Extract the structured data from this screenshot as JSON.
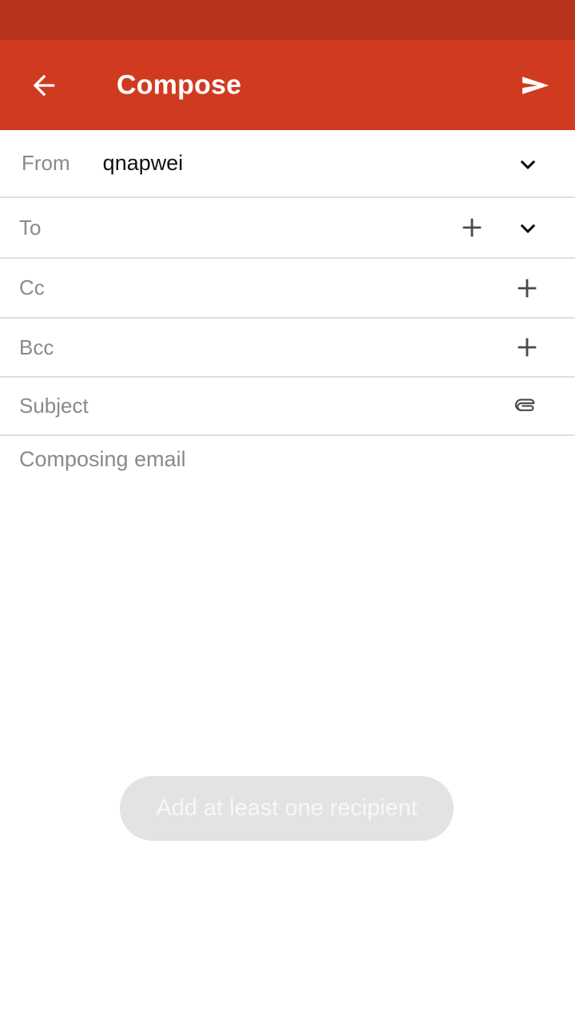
{
  "theme": {
    "status_bar_color": "#b8331c",
    "app_bar_color": "#d03b1f",
    "page_background": "#ffffff",
    "divider_color": "#dfdfdf",
    "label_color": "#8a8a8a",
    "value_color": "#111111",
    "toast_background": "#e3e3e3",
    "toast_text_color": "#f7f7f7"
  },
  "app_bar": {
    "title": "Compose",
    "back_icon": "arrow-left-icon",
    "send_icon": "send-icon"
  },
  "form": {
    "rows": [
      {
        "key": "from",
        "label": "From",
        "value": "qnapwei",
        "placeholder": "",
        "icons": [
          "chevron-down-icon"
        ]
      },
      {
        "key": "to",
        "label": "To",
        "value": "",
        "placeholder": "To",
        "icons": [
          "plus-icon",
          "chevron-down-icon"
        ]
      },
      {
        "key": "cc",
        "label": "Cc",
        "value": "",
        "placeholder": "Cc",
        "icons": [
          "plus-icon"
        ]
      },
      {
        "key": "bcc",
        "label": "Bcc",
        "value": "",
        "placeholder": "Bcc",
        "icons": [
          "plus-icon"
        ]
      },
      {
        "key": "subject",
        "label": "Subject",
        "value": "",
        "placeholder": "Subject",
        "icons": [
          "paperclip-icon"
        ]
      }
    ]
  },
  "body": {
    "placeholder": "Composing email",
    "value": ""
  },
  "toast": {
    "message": "Add at least one recipient",
    "visible": true
  }
}
